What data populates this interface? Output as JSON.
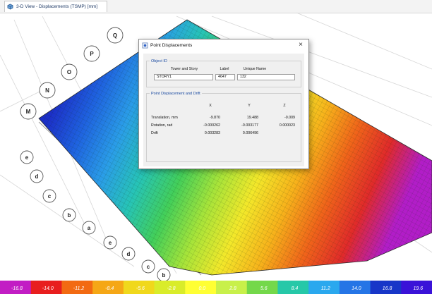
{
  "view_tab": {
    "title": "3-D View - Displacements (TSMP) [mm]",
    "icon": "view-3d-icon"
  },
  "grid_bubbles": {
    "top_row": [
      "M",
      "N",
      "O",
      "P",
      "Q"
    ],
    "side_row": [
      "e",
      "d",
      "c",
      "b",
      "a",
      "e",
      "d",
      "c",
      "b",
      "a"
    ]
  },
  "dialog": {
    "title": "Point Displacements",
    "close_glyph": "×",
    "object_id": {
      "legend": "Object ID",
      "headers": [
        "Tower and Story",
        "Label",
        "Unique Name"
      ],
      "story": "STORY1",
      "label": "4647",
      "unique_name": "132"
    },
    "displacement": {
      "legend": "Point Displacement and Drift",
      "col_headers": [
        "X",
        "Y",
        "Z"
      ],
      "rows": [
        {
          "label": "Translation, mm",
          "x": "-9.870",
          "y": "19.488",
          "z": "-0.009"
        },
        {
          "label": "Rotation, rad",
          "x": "-0.000262",
          "y": "-0.003177",
          "z": "0.000023"
        },
        {
          "label": "Drift",
          "x": "0.003283",
          "y": "0.006496",
          "z": ""
        }
      ]
    }
  },
  "legend": {
    "ticks": [
      "-16.8",
      "-14.0",
      "-11.2",
      "-8.4",
      "-5.6",
      "-2.8",
      "0.0",
      "2.8",
      "5.6",
      "8.4",
      "11.2",
      "14.0",
      "16.8",
      "19.6"
    ],
    "colors": [
      "#c21dc4",
      "#e81e1e",
      "#f26a12",
      "#f5a716",
      "#f0d81c",
      "#d9ec2a",
      "#ffff33",
      "#c8f04a",
      "#74d84a",
      "#26c8a8",
      "#2aa8ee",
      "#2575e6",
      "#1836c8",
      "#3a12d8"
    ]
  }
}
